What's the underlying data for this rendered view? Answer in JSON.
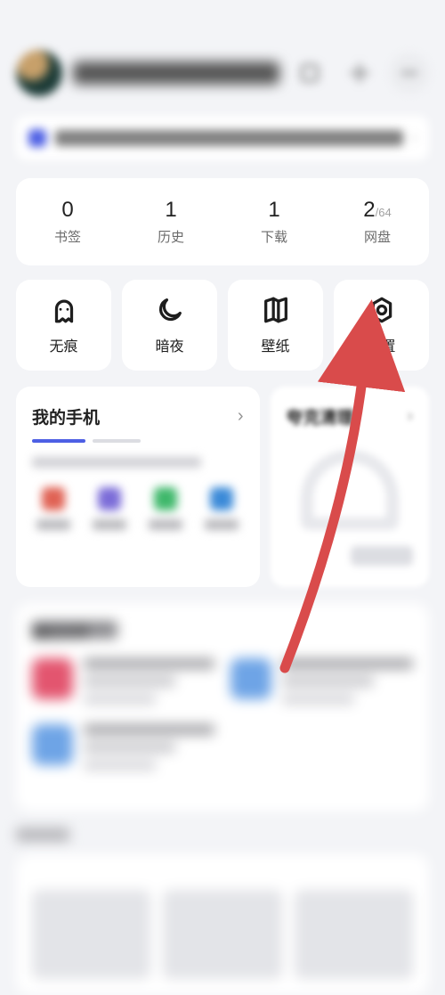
{
  "statusbar": {
    "time": "",
    "right": ""
  },
  "header": {
    "username": "",
    "scan_label": "扫一扫",
    "theme_label": "主题",
    "more_label": "更多"
  },
  "notice": {
    "text": ""
  },
  "stats": [
    {
      "count": "0",
      "label": "书签"
    },
    {
      "count": "1",
      "label": "历史"
    },
    {
      "count": "1",
      "label": "下载"
    },
    {
      "count": "2",
      "label": "网盘",
      "suffix": "/64"
    }
  ],
  "tools": [
    {
      "key": "incognito",
      "label": "无痕"
    },
    {
      "key": "dark",
      "label": "暗夜"
    },
    {
      "key": "wallpaper",
      "label": "壁纸"
    },
    {
      "key": "settings",
      "label": "设置"
    }
  ],
  "widgets": {
    "phone": {
      "title": "我的手机"
    },
    "clean": {
      "title": "夸克清理"
    }
  },
  "files": {
    "title": "最近文件"
  },
  "annotation": {
    "target": "settings"
  }
}
